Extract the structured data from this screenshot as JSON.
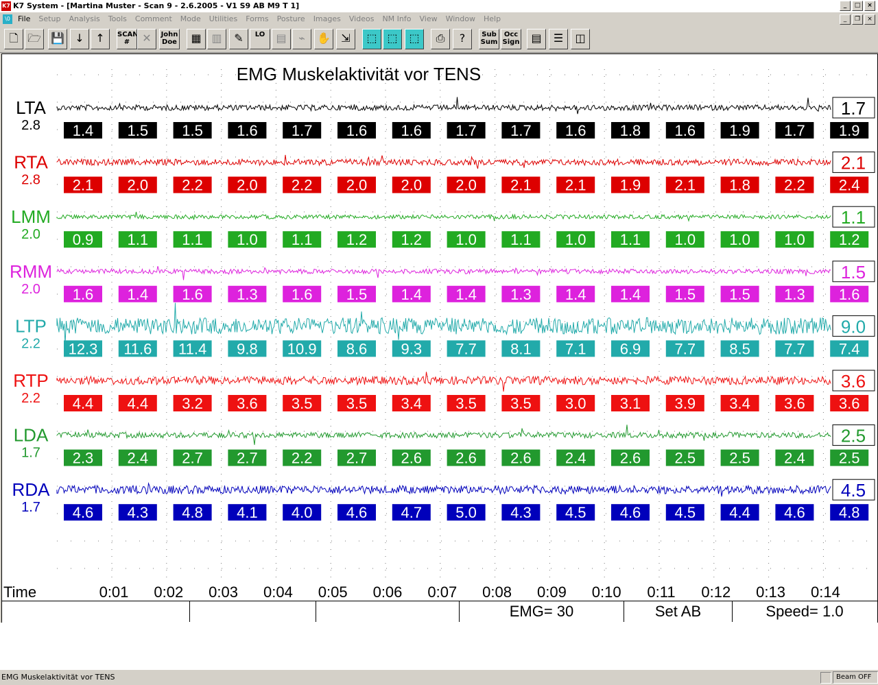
{
  "window": {
    "title": "K7 System - [Martina Muster - Scan 9 - 2.6.2005 - V1 S9 AB M9  T 1]",
    "app_icon": "K7"
  },
  "menu": {
    "doc_icon": "\\0",
    "items": [
      "File",
      "Setup",
      "Analysis",
      "Tools",
      "Comment",
      "Mode",
      "Utilities",
      "Forms",
      "Posture",
      "Images",
      "Videos",
      "NM Info",
      "View",
      "Window",
      "Help"
    ]
  },
  "toolbar": {
    "buttons": [
      {
        "name": "new-doc",
        "glyph": "🗋",
        "icon": "new-document-icon"
      },
      {
        "name": "open",
        "glyph": "🗁",
        "icon": "open-folder-icon"
      },
      {
        "name": "save",
        "glyph": "💾",
        "icon": "save-disk-icon",
        "dim": true
      },
      {
        "name": "down",
        "glyph": "↓",
        "icon": "arrow-down-icon"
      },
      {
        "name": "up",
        "glyph": "↑",
        "icon": "arrow-up-icon"
      },
      {
        "name": "scan",
        "glyph": "SCAN\n#",
        "icon": "scan-number-icon",
        "text": true
      },
      {
        "name": "tools-dim",
        "glyph": "✕",
        "icon": "crossed-tools-icon",
        "dim": true
      },
      {
        "name": "john-doe",
        "glyph": "John\nDoe",
        "icon": "john-doe-icon",
        "text": true
      },
      {
        "name": "table",
        "glyph": "▦",
        "icon": "table-icon"
      },
      {
        "name": "bars",
        "glyph": "▥",
        "icon": "bar-graph-icon",
        "dim": true
      },
      {
        "name": "pencil",
        "glyph": "✎",
        "icon": "pencil-icon"
      },
      {
        "name": "lo",
        "glyph": "LO",
        "icon": "lo-icon",
        "text": true
      },
      {
        "name": "grid-dim",
        "glyph": "▤",
        "icon": "grid-icon",
        "dim": true
      },
      {
        "name": "trace-dim",
        "glyph": "⌁",
        "icon": "trace-icon",
        "dim": true
      },
      {
        "name": "hand",
        "glyph": "✋",
        "icon": "hand-icon"
      },
      {
        "name": "cursor",
        "glyph": "⇲",
        "icon": "cursor-icon"
      },
      {
        "name": "cyan1",
        "glyph": "⬚",
        "icon": "layer-1-icon",
        "cyan": true
      },
      {
        "name": "cyan2",
        "glyph": "⬚",
        "icon": "layer-2-icon",
        "cyan": true
      },
      {
        "name": "cyan3",
        "glyph": "⬚",
        "icon": "layer-3-icon",
        "cyan": true
      },
      {
        "name": "print",
        "glyph": "⎙",
        "icon": "printer-icon"
      },
      {
        "name": "help",
        "glyph": "?",
        "icon": "help-pointer-icon"
      },
      {
        "name": "sub-sum",
        "glyph": "Sub\nSum",
        "icon": "sub-sum-icon",
        "text": true
      },
      {
        "name": "occ-sign",
        "glyph": "Occ\nSign",
        "icon": "occ-sign-icon",
        "text": true
      },
      {
        "name": "tile",
        "glyph": "▤",
        "icon": "tile-windows-icon"
      },
      {
        "name": "hsplit",
        "glyph": "☰",
        "icon": "horizontal-split-icon"
      },
      {
        "name": "vsplit",
        "glyph": "◫",
        "icon": "vertical-split-icon"
      }
    ]
  },
  "chart": {
    "title": "EMG Muskelaktivität vor TENS",
    "time_label": "Time",
    "time_ticks": [
      "0:01",
      "0:02",
      "0:03",
      "0:04",
      "0:05",
      "0:06",
      "0:07",
      "0:08",
      "0:09",
      "0:10",
      "0:11",
      "0:12",
      "0:13",
      "0:14"
    ]
  },
  "chart_data": {
    "type": "line",
    "title": "EMG Muskelaktivität vor TENS",
    "xlabel": "Time",
    "x": [
      "0:01",
      "0:02",
      "0:03",
      "0:04",
      "0:05",
      "0:06",
      "0:07",
      "0:08",
      "0:09",
      "0:10",
      "0:11",
      "0:12",
      "0:13",
      "0:14"
    ],
    "series": [
      {
        "name": "LTA",
        "scale": "2.8",
        "color": "#000000",
        "current": "1.7",
        "window_values": [
          "1.4",
          "1.5",
          "1.5",
          "1.6",
          "1.7",
          "1.6",
          "1.6",
          "1.7",
          "1.7",
          "1.6",
          "1.8",
          "1.6",
          "1.9",
          "1.7",
          "1.9"
        ]
      },
      {
        "name": "RTA",
        "scale": "2.8",
        "color": "#dd0000",
        "current": "2.1",
        "window_values": [
          "2.1",
          "2.0",
          "2.2",
          "2.0",
          "2.2",
          "2.0",
          "2.0",
          "2.0",
          "2.1",
          "2.1",
          "1.9",
          "2.1",
          "1.8",
          "2.2",
          "2.4"
        ]
      },
      {
        "name": "LMM",
        "scale": "2.0",
        "color": "#22aa22",
        "current": "1.1",
        "window_values": [
          "0.9",
          "1.1",
          "1.1",
          "1.0",
          "1.1",
          "1.2",
          "1.2",
          "1.0",
          "1.1",
          "1.0",
          "1.1",
          "1.0",
          "1.0",
          "1.0",
          "1.2"
        ]
      },
      {
        "name": "RMM",
        "scale": "2.0",
        "color": "#dd22dd",
        "current": "1.5",
        "window_values": [
          "1.6",
          "1.4",
          "1.6",
          "1.3",
          "1.6",
          "1.5",
          "1.4",
          "1.4",
          "1.3",
          "1.4",
          "1.4",
          "1.5",
          "1.5",
          "1.3",
          "1.6"
        ]
      },
      {
        "name": "LTP",
        "scale": "2.2",
        "color": "#22aaaa",
        "current": "9.0",
        "window_values": [
          "12.3",
          "11.6",
          "11.4",
          "9.8",
          "10.9",
          "8.6",
          "9.3",
          "7.7",
          "8.1",
          "7.1",
          "6.9",
          "7.7",
          "8.5",
          "7.7",
          "7.4"
        ]
      },
      {
        "name": "RTP",
        "scale": "2.2",
        "color": "#ee1111",
        "current": "3.6",
        "window_values": [
          "4.4",
          "4.4",
          "3.2",
          "3.6",
          "3.5",
          "3.5",
          "3.4",
          "3.5",
          "3.5",
          "3.0",
          "3.1",
          "3.9",
          "3.4",
          "3.6",
          "3.6"
        ]
      },
      {
        "name": "LDA",
        "scale": "1.7",
        "color": "#22992e",
        "current": "2.5",
        "window_values": [
          "2.3",
          "2.4",
          "2.7",
          "2.7",
          "2.2",
          "2.7",
          "2.6",
          "2.6",
          "2.6",
          "2.4",
          "2.6",
          "2.5",
          "2.5",
          "2.4",
          "2.5"
        ]
      },
      {
        "name": "RDA",
        "scale": "1.7",
        "color": "#0000bb",
        "current": "4.5",
        "window_values": [
          "4.6",
          "4.3",
          "4.8",
          "4.1",
          "4.0",
          "4.6",
          "4.7",
          "5.0",
          "4.3",
          "4.5",
          "4.6",
          "4.5",
          "4.4",
          "4.6",
          "4.8"
        ]
      }
    ]
  },
  "status_row": {
    "emg": "EMG= 30",
    "set": "Set AB",
    "speed": "Speed= 1.0"
  },
  "statusbar": {
    "left": "EMG Muskelaktivität vor TENS",
    "beam": "Beam OFF"
  }
}
